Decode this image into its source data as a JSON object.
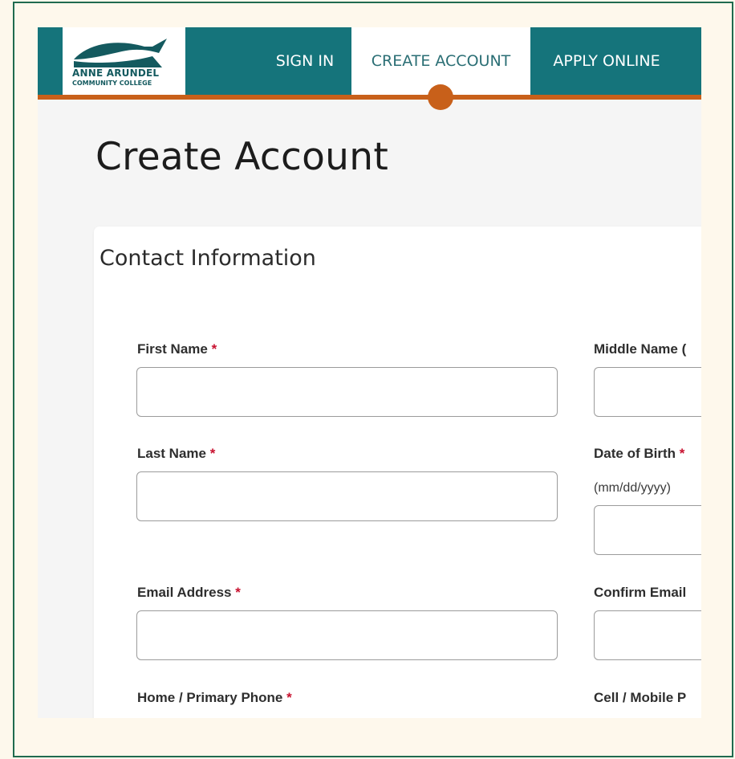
{
  "logo": {
    "line1": "ANNE ARUNDEL",
    "line2": "COMMUNITY COLLEGE",
    "icon": "seagull-logo-icon"
  },
  "nav": {
    "sign_in": "SIGN IN",
    "create_account": "CREATE ACCOUNT",
    "apply_online": "APPLY ONLINE",
    "active": "CREATE ACCOUNT"
  },
  "page": {
    "title": "Create Account"
  },
  "form": {
    "section_title": "Contact Information",
    "required_marker": "*",
    "first_name": {
      "label": "First Name",
      "value": ""
    },
    "middle_name": {
      "label": "Middle Name (",
      "value": ""
    },
    "last_name": {
      "label": "Last Name",
      "value": ""
    },
    "date_of_birth": {
      "label": "Date of Birth",
      "hint": "(mm/dd/yyyy)",
      "value": ""
    },
    "email": {
      "label": "Email Address",
      "value": ""
    },
    "confirm_email": {
      "label": "Confirm Email",
      "value": ""
    },
    "home_phone": {
      "label": "Home / Primary Phone"
    },
    "cell_phone": {
      "label": "Cell / Mobile P"
    }
  },
  "colors": {
    "nav_teal": "#15747b",
    "accent_orange": "#c8601a",
    "required_red": "#c8102e",
    "page_background": "#fdf8ec"
  }
}
